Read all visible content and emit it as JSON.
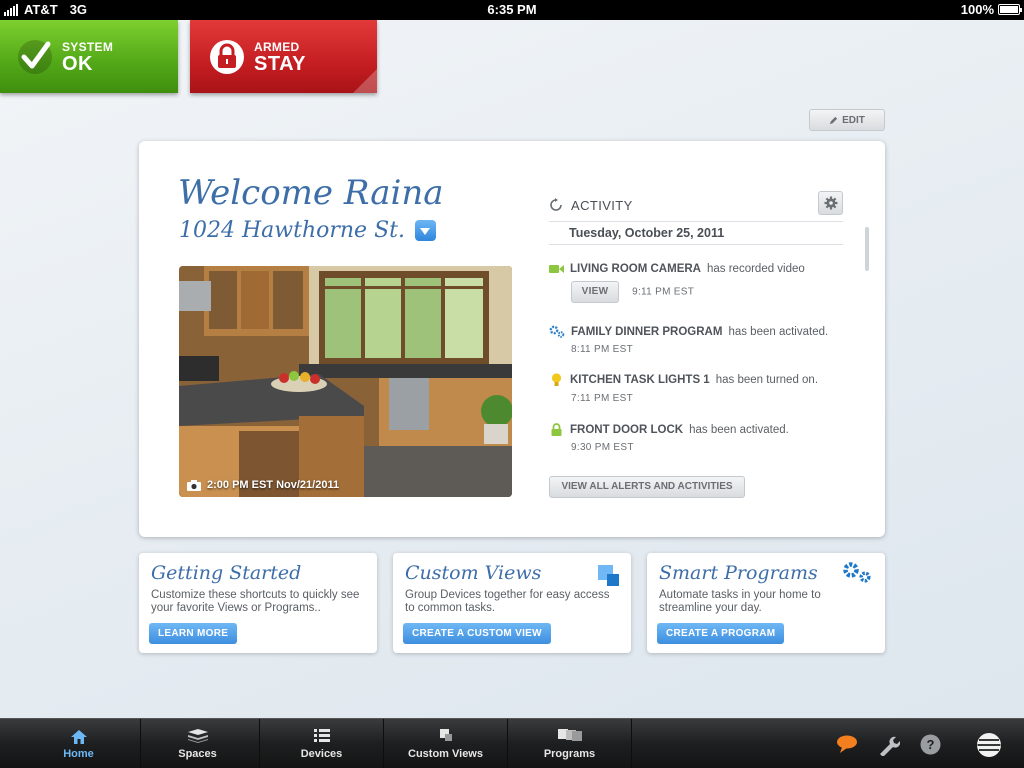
{
  "status_bar": {
    "carrier": "AT&T",
    "network": "3G",
    "time": "6:35 PM",
    "battery": "100%"
  },
  "system_tile": {
    "label": "SYSTEM",
    "value": "OK",
    "color": "#52a718"
  },
  "armed_tile": {
    "label": "ARMED",
    "value": "STAY",
    "color": "#c51e22"
  },
  "edit_label": "EDIT",
  "welcome": {
    "title": "Welcome Raina",
    "address": "1024 Hawthorne St."
  },
  "camera": {
    "timestamp": "2:00 PM EST Nov/21/2011"
  },
  "activity": {
    "title": "ACTIVITY",
    "date": "Tuesday, October 25, 2011",
    "view_label": "VIEW",
    "view_all_label": "VIEW ALL ALERTS AND ACTIVITIES",
    "items": [
      {
        "name": "LIVING ROOM CAMERA",
        "text": "has recorded video",
        "time": "9:11 PM  EST",
        "icon": "video-icon",
        "icon_color": "#8dc63f"
      },
      {
        "name": "FAMILY DINNER PROGRAM",
        "text": "has been activated.",
        "time": "8:11 PM  EST",
        "icon": "gears-icon",
        "icon_color": "#2f7fc9"
      },
      {
        "name": "KITCHEN TASK LIGHTS 1",
        "text": "has been turned on.",
        "time": "7:11 PM  EST",
        "icon": "bulb-icon",
        "icon_color": "#f2c81d"
      },
      {
        "name": "FRONT DOOR LOCK",
        "text": "has been activated.",
        "time": "9:30 PM  EST",
        "icon": "lock-icon",
        "icon_color": "#8dc63f"
      }
    ]
  },
  "cards": [
    {
      "title": "Getting Started",
      "desc": "Customize these shortcuts to quickly see your favorite Views or Programs..",
      "button": "LEARN MORE"
    },
    {
      "title": "Custom Views",
      "desc": "Group Devices together for easy access to common tasks.",
      "button": "CREATE A CUSTOM VIEW"
    },
    {
      "title": "Smart Programs",
      "desc": "Automate tasks in your home to streamline your day.",
      "button": "CREATE A PROGRAM"
    }
  ],
  "tabs": [
    {
      "label": "Home",
      "active": true
    },
    {
      "label": "Spaces",
      "active": false
    },
    {
      "label": "Devices",
      "active": false
    },
    {
      "label": "Custom Views",
      "active": false
    },
    {
      "label": "Programs",
      "active": false
    }
  ],
  "colors": {
    "accent": "#3d6ea8",
    "button_blue": "#3d8ee0",
    "tab_active": "#6cb8f5"
  }
}
